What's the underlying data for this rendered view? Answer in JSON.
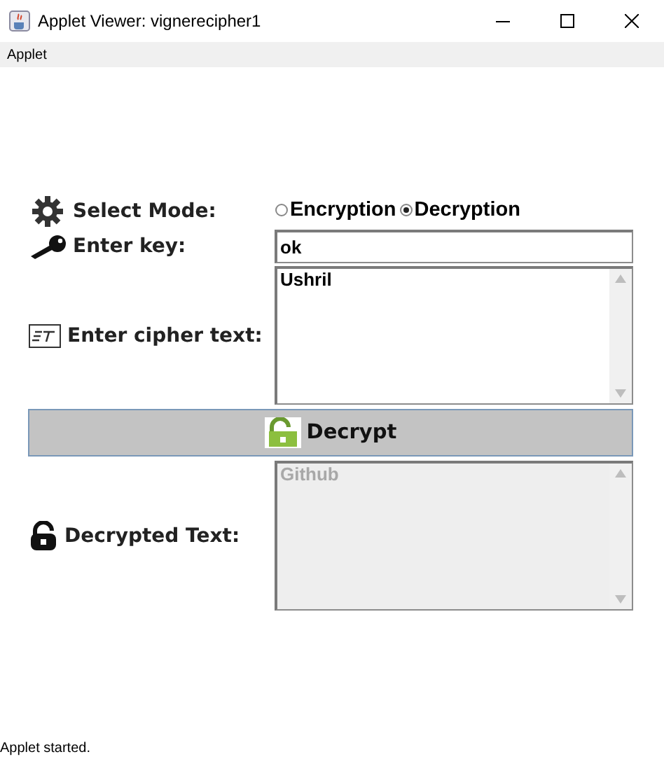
{
  "window": {
    "title": "Applet Viewer: vignerecipher1"
  },
  "menu_bar": {
    "items": [
      "Applet"
    ]
  },
  "mode": {
    "label": "Select Mode:",
    "options": [
      {
        "label": "Encryption",
        "selected": false
      },
      {
        "label": "Decryption",
        "selected": true
      }
    ]
  },
  "key": {
    "label": "Enter key:",
    "value": "ok"
  },
  "cipher_text": {
    "label": "Enter cipher text:",
    "value": "Ushril"
  },
  "action_button": {
    "label": "Decrypt"
  },
  "output": {
    "label": "Decrypted Text:",
    "value": "Github",
    "disabled": true
  },
  "status_bar": "Applet started."
}
